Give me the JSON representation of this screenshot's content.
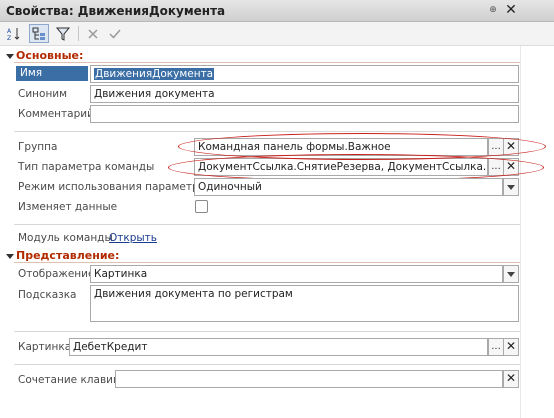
{
  "window": {
    "title": "Свойства: ДвиженияДокумента"
  },
  "toolbar": {
    "sort_icon": "sort-az-icon",
    "categories_icon": "categories-icon",
    "filter_icon": "filter-icon",
    "cancel_icon": "cancel-icon",
    "ok_icon": "checkmark-icon"
  },
  "main_section": {
    "title": "Основные:",
    "name_label": "Имя",
    "name_value": "ДвиженияДокумента",
    "synonym_label": "Синоним",
    "synonym_value": "Движения документа",
    "comment_label": "Комментарий",
    "comment_value": "",
    "group_label": "Группа",
    "group_value": "Командная панель формы.Важное",
    "param_type_label": "Тип параметра команды",
    "param_type_value": "ДокументСсылка.СнятиеРезерва, ДокументСсылка.Рас",
    "param_mode_label": "Режим использования параметра",
    "param_mode_value": "Одиночный",
    "modifies_label": "Изменяет данные",
    "module_label": "Модуль команды",
    "module_link": "Открыть"
  },
  "view_section": {
    "title": "Представление:",
    "display_label": "Отображение",
    "display_value": "Картинка",
    "tooltip_label": "Подсказка",
    "tooltip_value": "Движения документа по регистрам",
    "picture_label": "Картинка",
    "picture_value": "ДебетКредит",
    "shortcut_label": "Сочетание клавиш",
    "shortcut_value": ""
  },
  "buttons": {
    "ellipsis": "...",
    "clear": "✕"
  },
  "colors": {
    "section_title": "#b22a00",
    "selection": "#3a6ea5",
    "highlight_ellipse": "#c8201a"
  }
}
